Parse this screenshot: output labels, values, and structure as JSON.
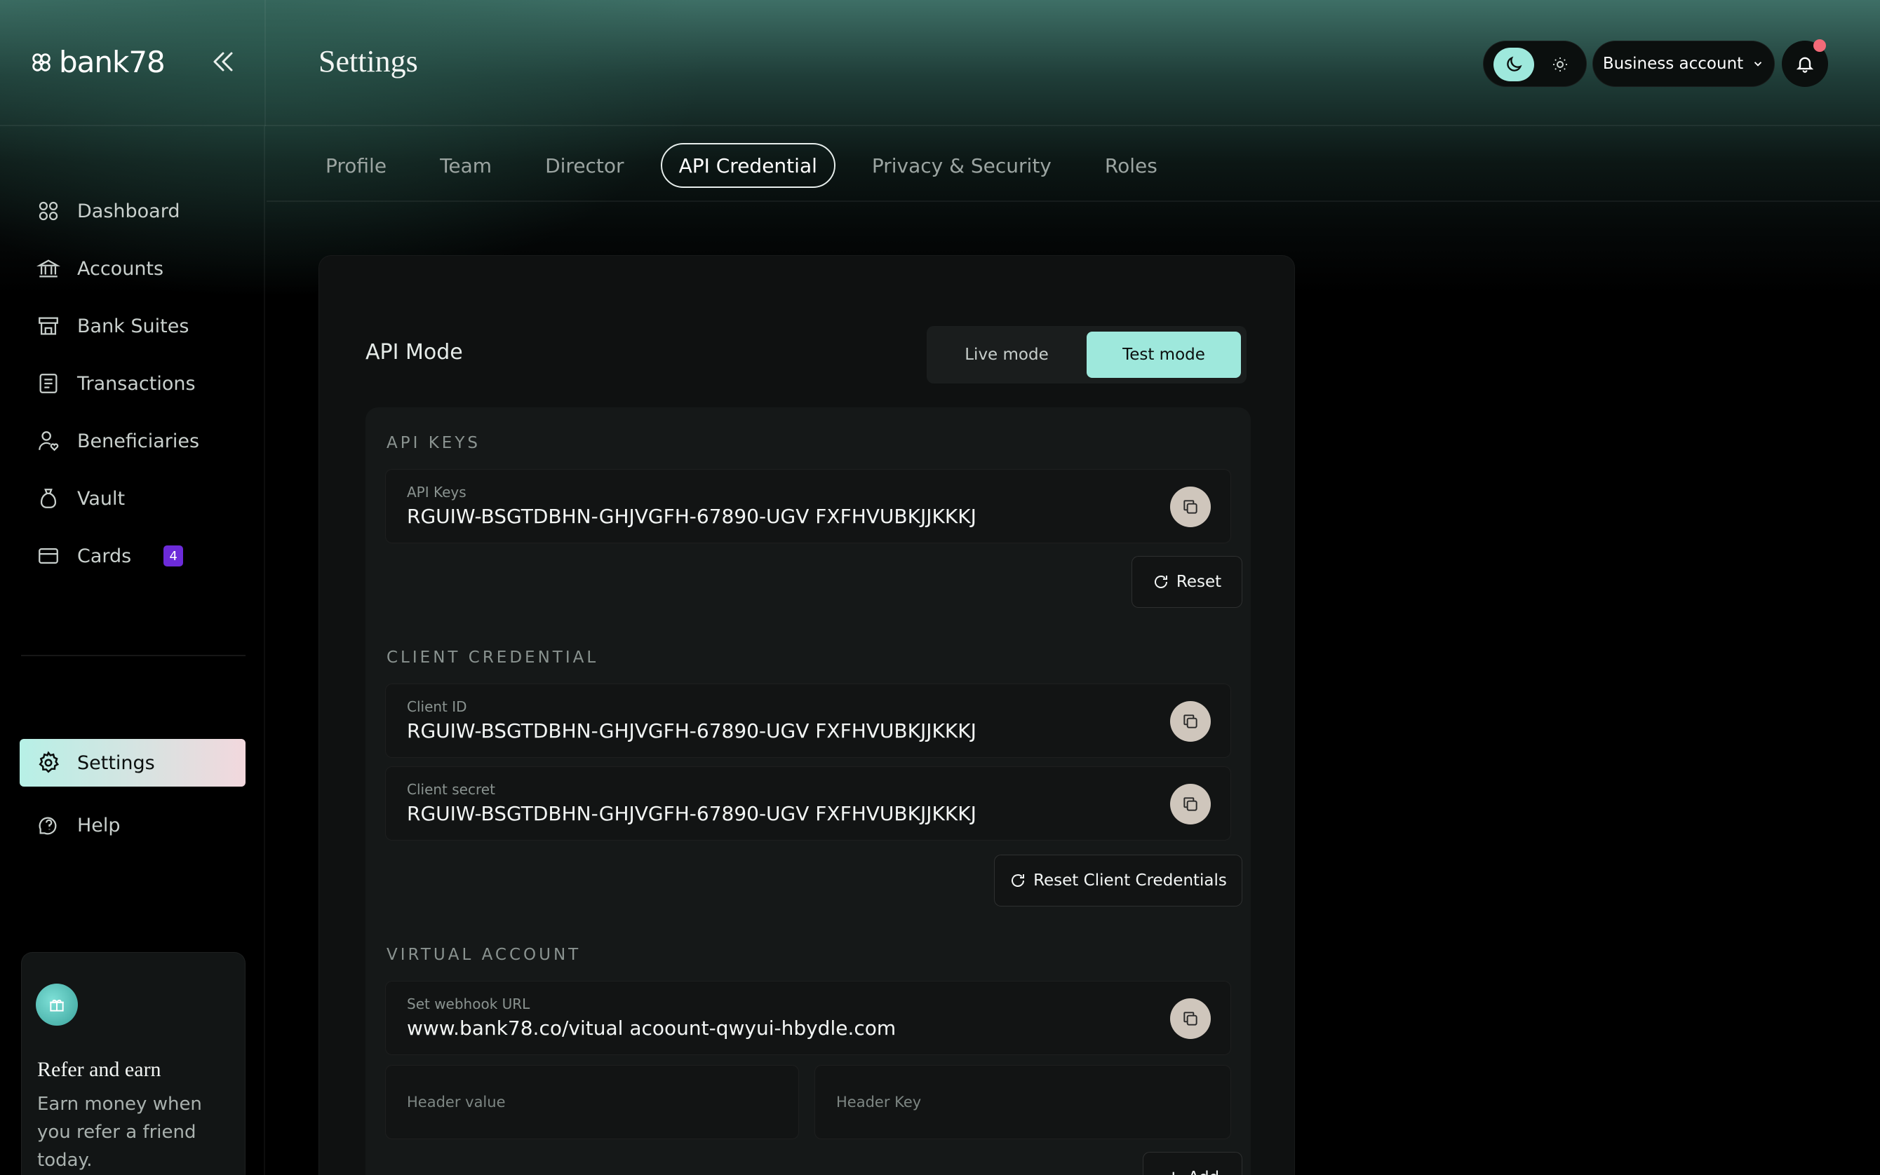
{
  "app": {
    "brand": "bank78",
    "page_title": "Settings"
  },
  "header": {
    "account_label": "Business account"
  },
  "sidebar": {
    "items": [
      {
        "label": "Dashboard",
        "icon": "grid-icon"
      },
      {
        "label": "Accounts",
        "icon": "bank-icon"
      },
      {
        "label": "Bank Suites",
        "icon": "store-icon"
      },
      {
        "label": "Transactions",
        "icon": "receipt-icon"
      },
      {
        "label": "Beneficiaries",
        "icon": "user-heart-icon"
      },
      {
        "label": "Vault",
        "icon": "bag-icon"
      },
      {
        "label": "Cards",
        "icon": "card-icon",
        "badge": "4"
      }
    ],
    "bottom_items": [
      {
        "label": "Settings",
        "icon": "gear-icon",
        "active": true
      },
      {
        "label": "Help",
        "icon": "help-icon"
      }
    ],
    "refer": {
      "title": "Refer and earn",
      "body": "Earn money when you refer a friend today."
    }
  },
  "tabs": [
    {
      "label": "Profile"
    },
    {
      "label": "Team"
    },
    {
      "label": "Director"
    },
    {
      "label": "API Credential",
      "active": true
    },
    {
      "label": "Privacy & Security"
    },
    {
      "label": "Roles"
    }
  ],
  "api": {
    "mode_label": "API Mode",
    "live_label": "Live mode",
    "test_label": "Test mode",
    "selected_mode": "Test mode",
    "keys_section": "API KEYS",
    "api_key_label": "API Keys",
    "api_key_value": "RGUIW-BSGTDBHN-GHJVGFH-67890-UGV FXFHVUBKJJKKKJ",
    "reset_label": "Reset",
    "client_section": "CLIENT CREDENTIAL",
    "client_id_label": "Client ID",
    "client_id_value": "RGUIW-BSGTDBHN-GHJVGFH-67890-UGV FXFHVUBKJJKKKJ",
    "client_secret_label": "Client secret",
    "client_secret_value": "RGUIW-BSGTDBHN-GHJVGFH-67890-UGV FXFHVUBKJJKKKJ",
    "reset_client_label": "Reset Client Credentials",
    "virtual_section": "VIRTUAL ACCOUNT",
    "webhook_label": "Set webhook URL",
    "webhook_value": "www.bank78.co/vitual acoount-qwyui-hbydle.com",
    "header_value_placeholder": "Header value",
    "header_key_placeholder": "Header Key",
    "add_label": "Add"
  },
  "colors": {
    "accent": "#9ee8dc",
    "badge": "#6c2bd9",
    "notification": "#f36a78"
  }
}
